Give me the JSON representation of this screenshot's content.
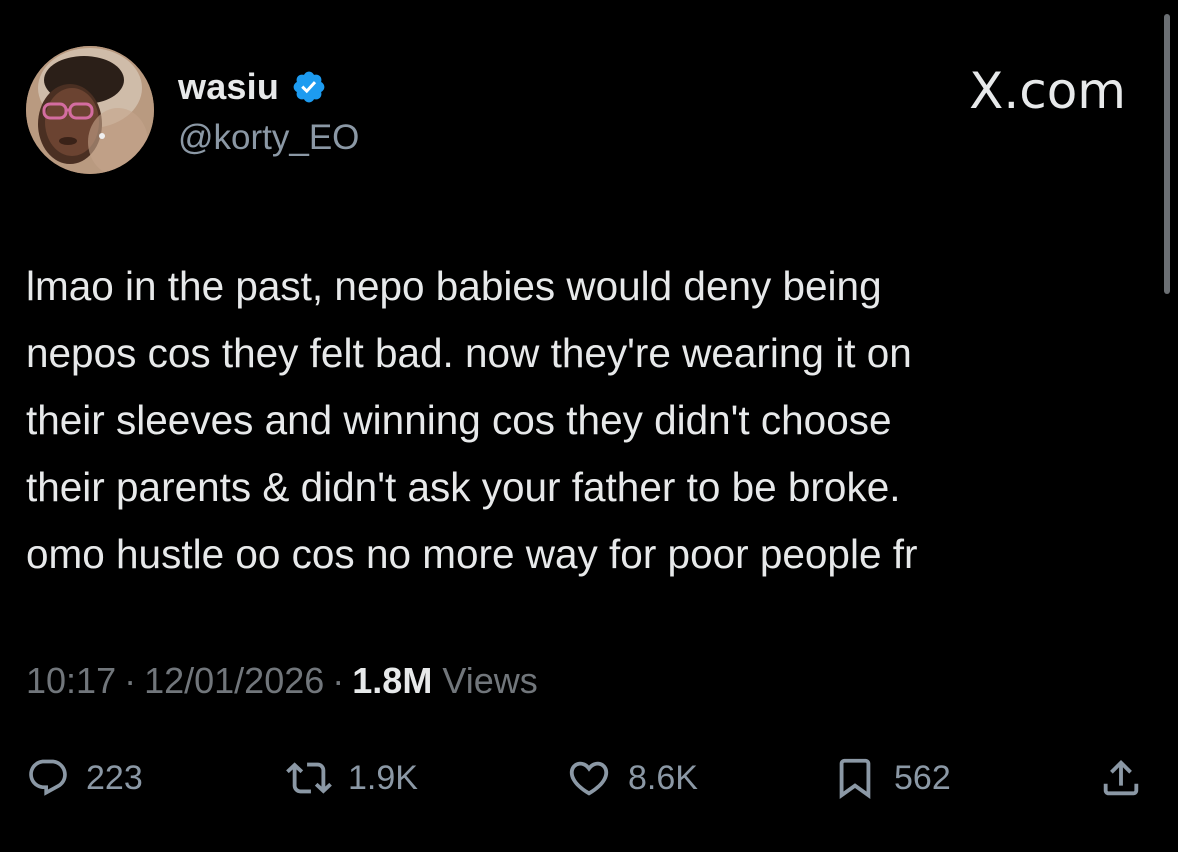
{
  "author": {
    "name": "wasiu",
    "handle": "@korty_EO",
    "verified": true
  },
  "brand": "X.com",
  "tweet": {
    "text": "lmao in the past, nepo babies would deny being\nnepos cos they felt bad. now they're wearing it on\ntheir sleeves and winning cos they didn't choose\ntheir parents & didn't ask your father to be broke.\nomo hustle oo cos no more way for poor people fr"
  },
  "meta": {
    "time": "10:17",
    "separator": "·",
    "date": "12/01/2026",
    "views_count": "1.8M",
    "views_label": "Views"
  },
  "actions": {
    "replies": "223",
    "reposts": "1.9K",
    "likes": "8.6K",
    "bookmarks": "562"
  },
  "icons": {
    "reply": "speech-bubble-icon",
    "repost": "repost-arrows-icon",
    "like": "heart-icon",
    "bookmark": "bookmark-icon",
    "share": "share-upload-icon",
    "verified": "verified-badge-icon"
  },
  "colors": {
    "background": "#000000",
    "primary_text": "#e7e9ea",
    "secondary_text": "#71767b",
    "verified_blue": "#1d9bf0"
  }
}
